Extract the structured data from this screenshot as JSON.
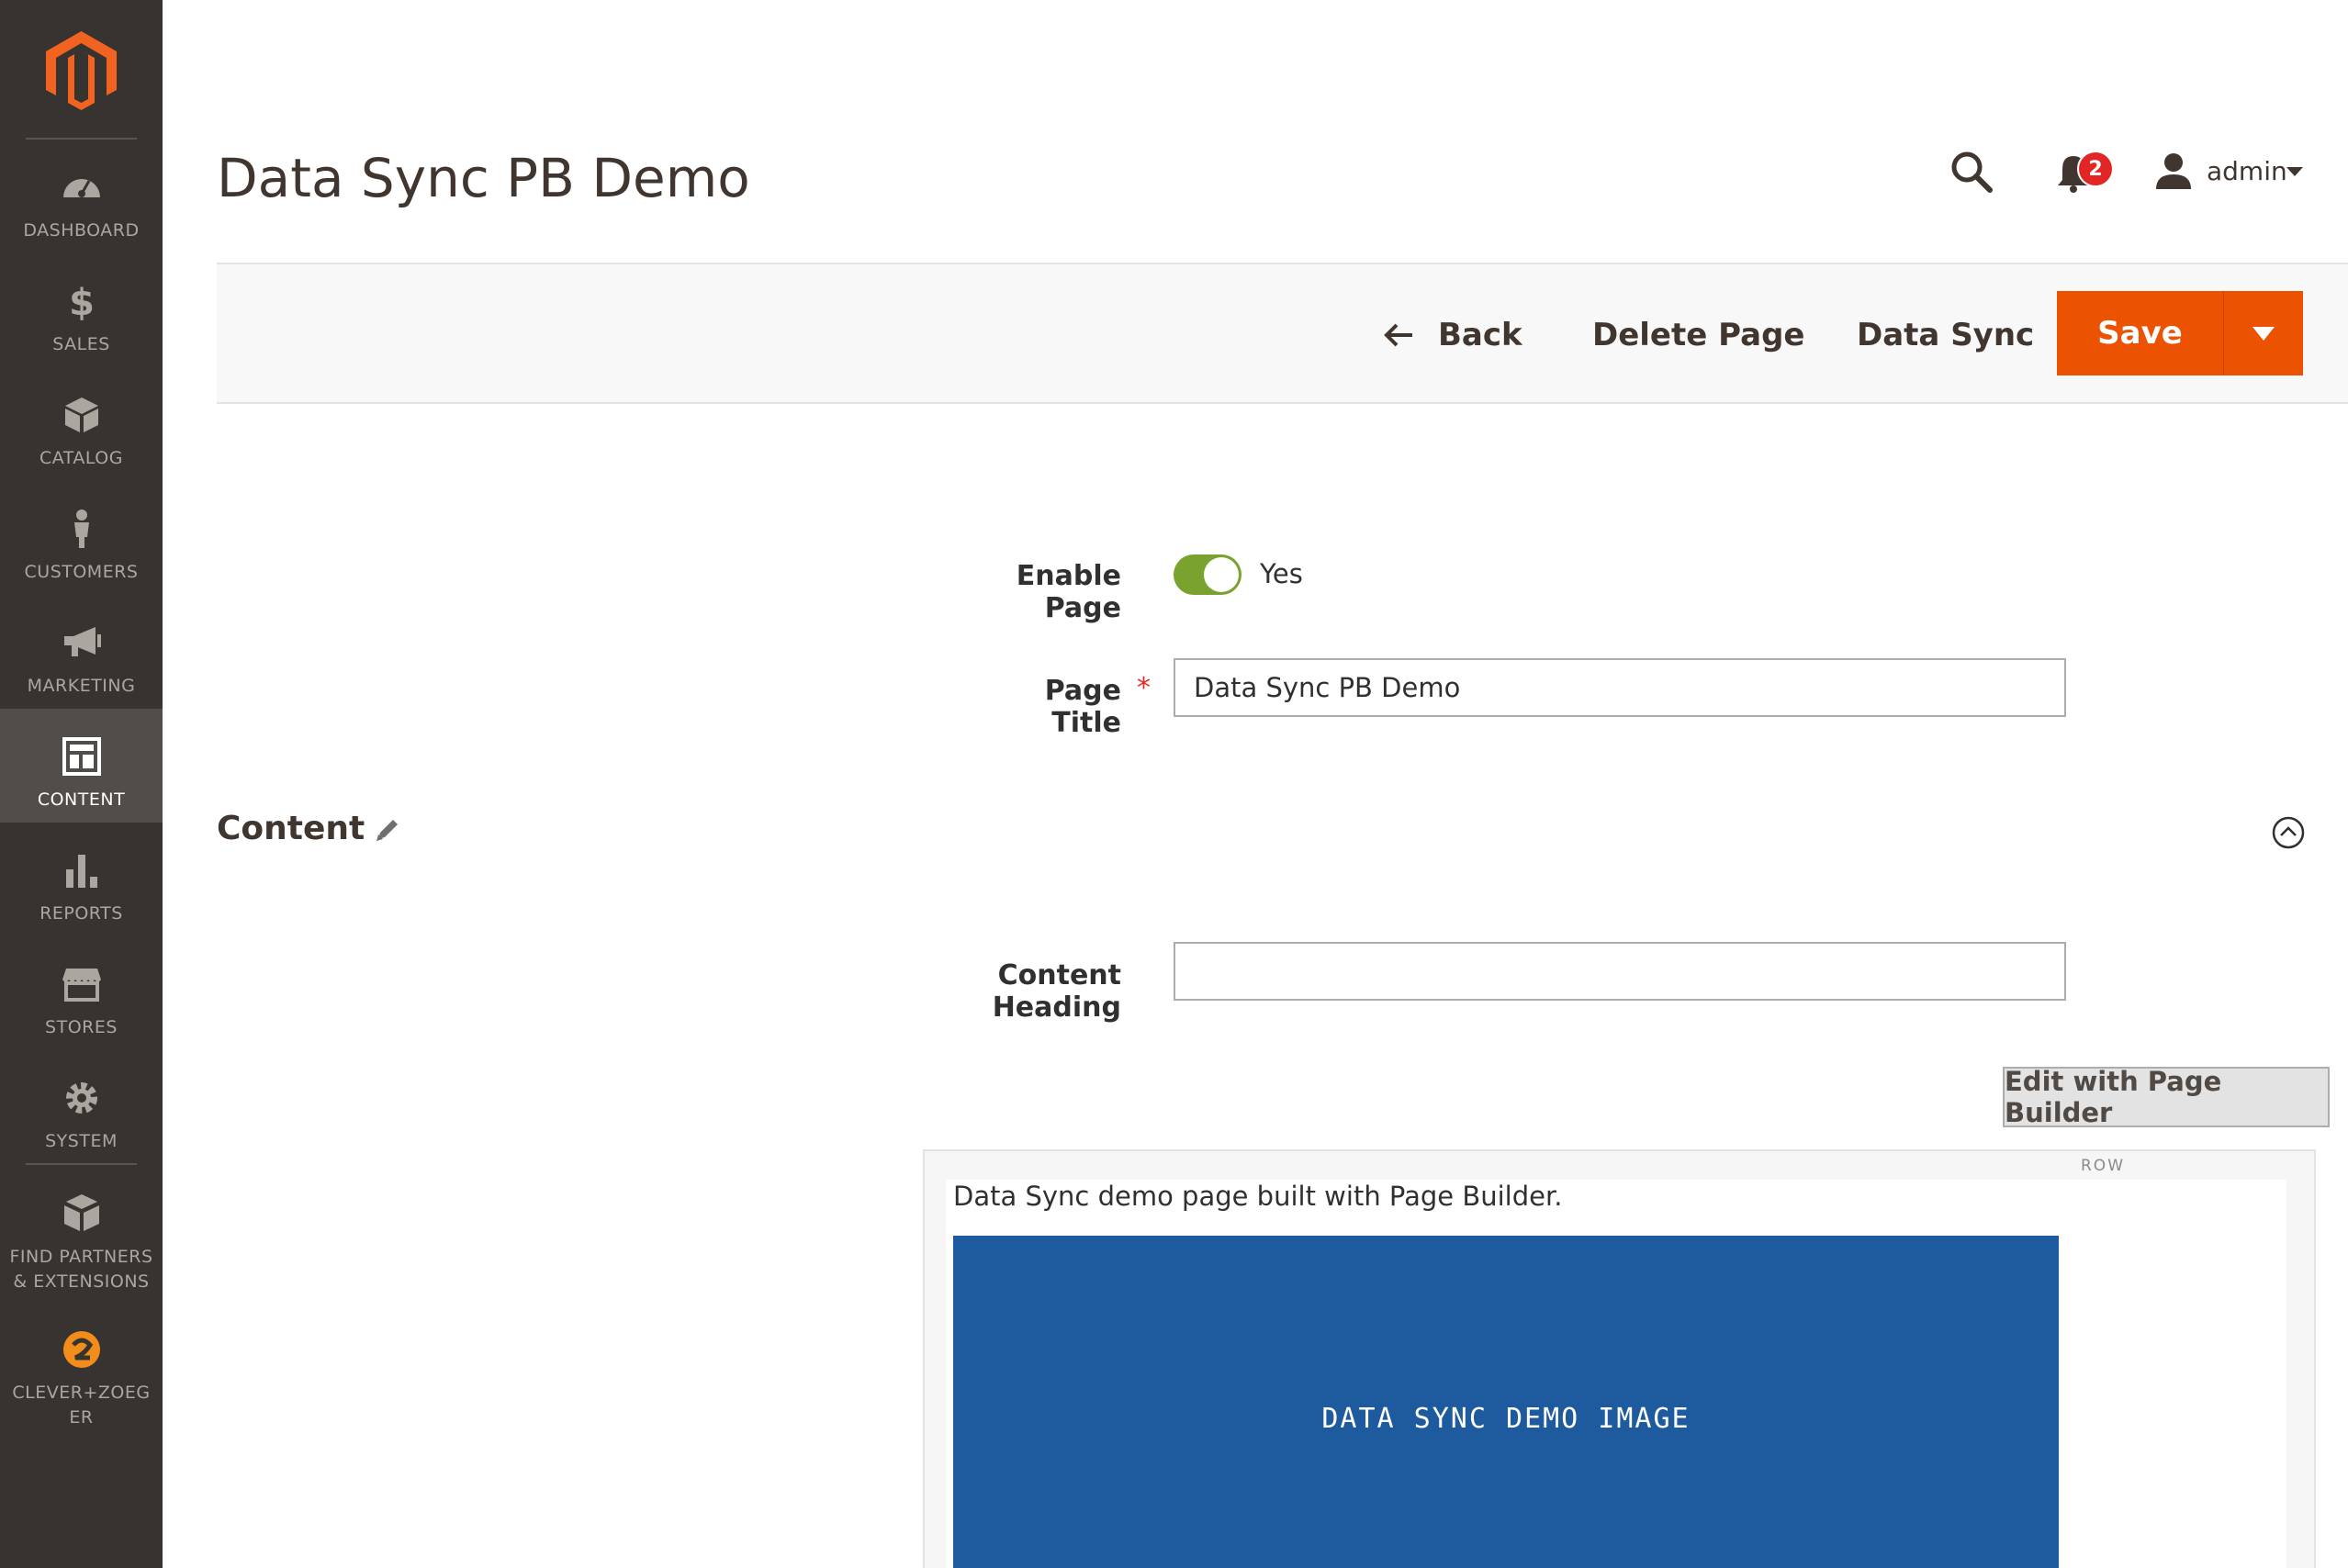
{
  "sidebar": {
    "logo": "magento-logo-icon",
    "items": [
      {
        "label": "DASHBOARD",
        "icon": "dashboard-icon"
      },
      {
        "label": "SALES",
        "icon": "dollar-icon"
      },
      {
        "label": "CATALOG",
        "icon": "box-icon"
      },
      {
        "label": "CUSTOMERS",
        "icon": "person-icon"
      },
      {
        "label": "MARKETING",
        "icon": "megaphone-icon"
      },
      {
        "label": "CONTENT",
        "icon": "layout-icon",
        "active": true
      },
      {
        "label": "REPORTS",
        "icon": "bar-chart-icon"
      },
      {
        "label": "STORES",
        "icon": "storefront-icon"
      },
      {
        "label": "SYSTEM",
        "icon": "gear-icon"
      },
      {
        "label": "FIND PARTNERS & EXTENSIONS",
        "icon": "cubes-icon"
      },
      {
        "label": "CLEVER+ZOEGER",
        "icon": "clever-zoeger-icon"
      }
    ]
  },
  "header": {
    "title": "Data Sync PB Demo",
    "notifications_count": "2",
    "user": "admin"
  },
  "actions": {
    "back": "Back",
    "delete": "Delete Page",
    "data_sync": "Data Sync",
    "save": "Save"
  },
  "form": {
    "enable_page_label": "Enable Page",
    "enable_page_value": "Yes",
    "page_title_label": "Page Title",
    "required_mark": "*",
    "page_title_value": "Data Sync PB Demo",
    "content_section_title": "Content",
    "content_heading_label": "Content Heading",
    "content_heading_value": "",
    "edit_page_builder": "Edit with Page Builder"
  },
  "preview": {
    "row_tag": "ROW",
    "text": "Data Sync demo page built with Page Builder.",
    "image_caption": "DATA SYNC DEMO IMAGE",
    "image_color": "#1e5a9e"
  },
  "colors": {
    "sidebar_bg": "#373330",
    "accent": "#eb5202",
    "toggle_on": "#79a22e",
    "badge": "#e22626"
  }
}
